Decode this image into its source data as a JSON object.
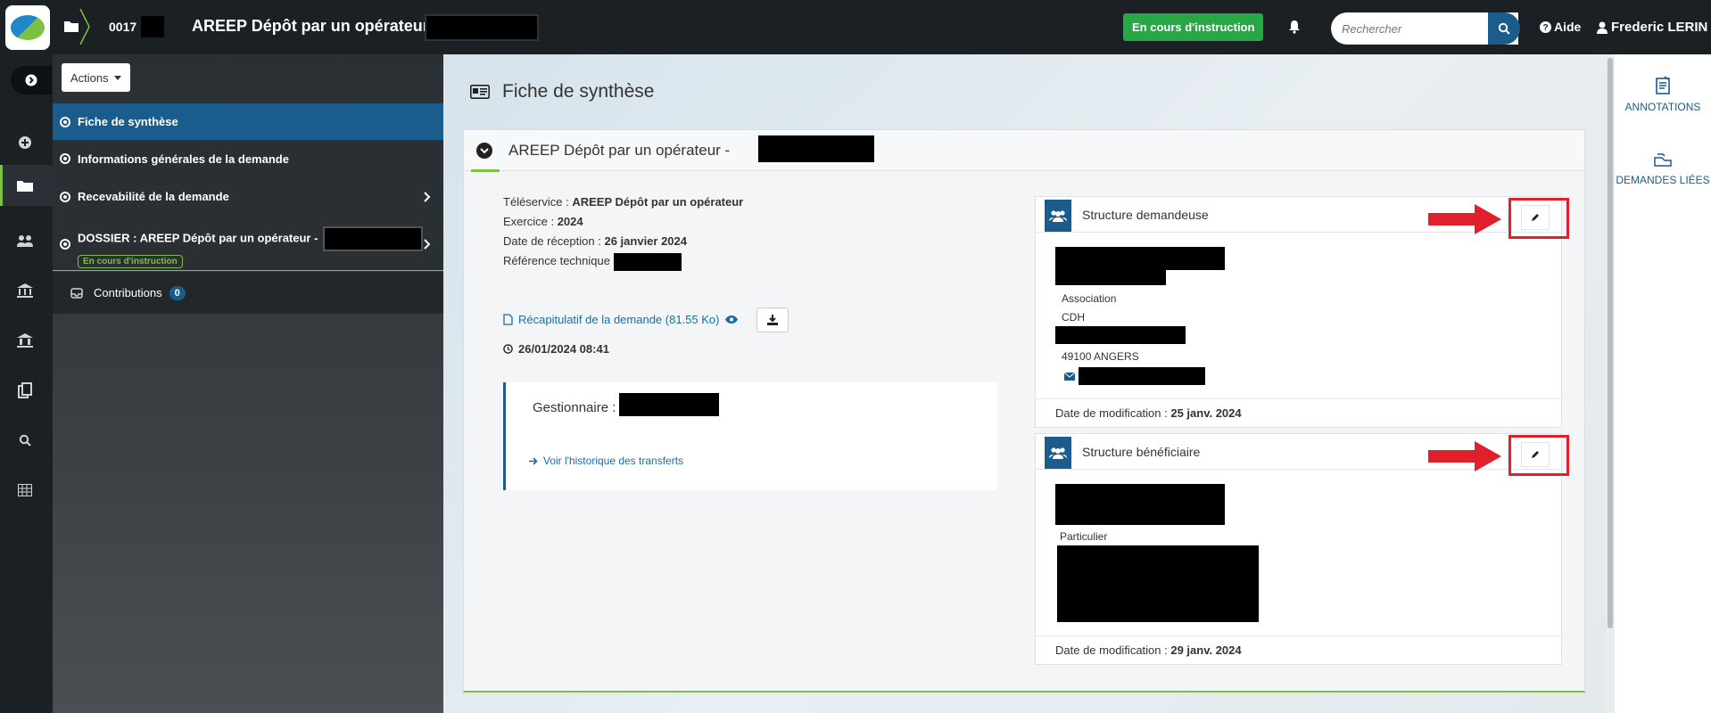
{
  "topbar": {
    "dossier_number": "0017",
    "app_title": "AREEP Dépôt par un opérateur -",
    "status_label": "En cours d'instruction",
    "search_placeholder": "Rechercher",
    "help_label": "Aide",
    "user_name": "Frederic LERIN"
  },
  "sidemenu": {
    "actions_label": "Actions",
    "items": [
      {
        "label": "Fiche de synthèse"
      },
      {
        "label": "Informations générales de la demande"
      },
      {
        "label": "Recevabilité de la demande"
      },
      {
        "label": "DOSSIER : AREEP Dépôt par un opérateur -",
        "badge": "En cours d'instruction"
      }
    ],
    "contributions_label": "Contributions",
    "contributions_count": "0"
  },
  "main": {
    "page_title": "Fiche de synthèse",
    "card_title": "AREEP Dépôt par un opérateur -",
    "meta": {
      "teleservice_label": "Téléservice :",
      "teleservice_value": "AREEP Dépôt par un opérateur",
      "exercice_label": "Exercice :",
      "exercice_value": "2024",
      "reception_label": "Date de réception :",
      "reception_value": "26 janvier 2024",
      "reference_label": "Référence technique"
    },
    "recap_link": "Récapitulatif de la demande (81.55 Ko)",
    "recap_date": "26/01/2024 08:41",
    "gestionnaire_label": "Gestionnaire :",
    "history_link": "Voir l'historique des transferts",
    "structure_demandeuse": {
      "title": "Structure demandeuse",
      "type": "Association",
      "line2": "CDH",
      "city": "49100 ANGERS",
      "modified_label": "Date de modification :",
      "modified_value": "25 janv. 2024"
    },
    "structure_beneficiaire": {
      "title": "Structure bénéficiaire",
      "type": "Particulier",
      "modified_label": "Date de modification :",
      "modified_value": "29 janv. 2024"
    }
  },
  "rightpanel": {
    "annotations_label": "ANNOTATIONS",
    "linked_label": "DEMANDES LIÉES"
  },
  "colors": {
    "primary_blue": "#1a5c8c",
    "status_green": "#28a745",
    "accent_green": "#7cc242",
    "highlight_red": "#e0202a"
  }
}
